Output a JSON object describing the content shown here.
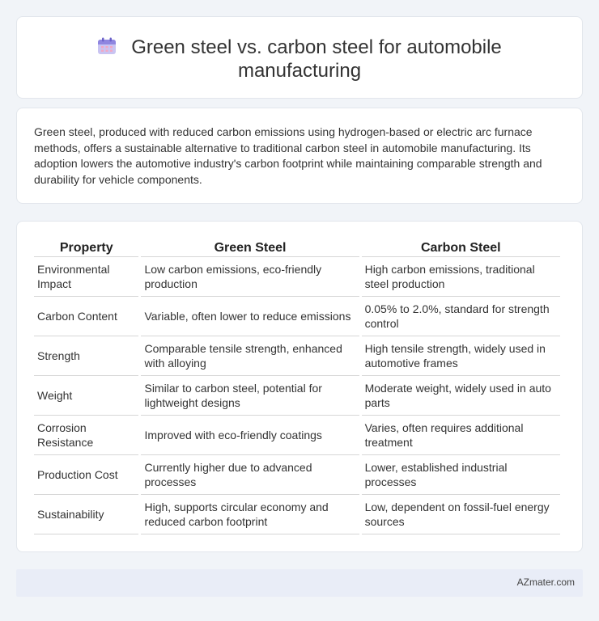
{
  "header": {
    "icon": "calendar-icon",
    "title_line1": "Green steel vs. carbon steel for automobile",
    "title_line2": "manufacturing"
  },
  "intro": {
    "text": "Green steel, produced with reduced carbon emissions using hydrogen-based or electric arc furnace methods, offers a sustainable alternative to traditional carbon steel in automobile manufacturing. Its adoption lowers the automotive industry's carbon footprint while maintaining comparable strength and durability for vehicle components."
  },
  "table": {
    "headers": [
      "Property",
      "Green Steel",
      "Carbon Steel"
    ],
    "rows": [
      [
        "Environmental Impact",
        "Low carbon emissions, eco-friendly production",
        "High carbon emissions, traditional steel production"
      ],
      [
        "Carbon Content",
        "Variable, often lower to reduce emissions",
        "0.05% to 2.0%, standard for strength control"
      ],
      [
        "Strength",
        "Comparable tensile strength, enhanced with alloying",
        "High tensile strength, widely used in automotive frames"
      ],
      [
        "Weight",
        "Similar to carbon steel, potential for lightweight designs",
        "Moderate weight, widely used in auto parts"
      ],
      [
        "Corrosion Resistance",
        "Improved with eco-friendly coatings",
        "Varies, often requires additional treatment"
      ],
      [
        "Production Cost",
        "Currently higher due to advanced processes",
        "Lower, established industrial processes"
      ],
      [
        "Sustainability",
        "High, supports circular economy and reduced carbon footprint",
        "Low, dependent on fossil-fuel energy sources"
      ]
    ]
  },
  "footer": {
    "brand": "AZmater.com"
  }
}
